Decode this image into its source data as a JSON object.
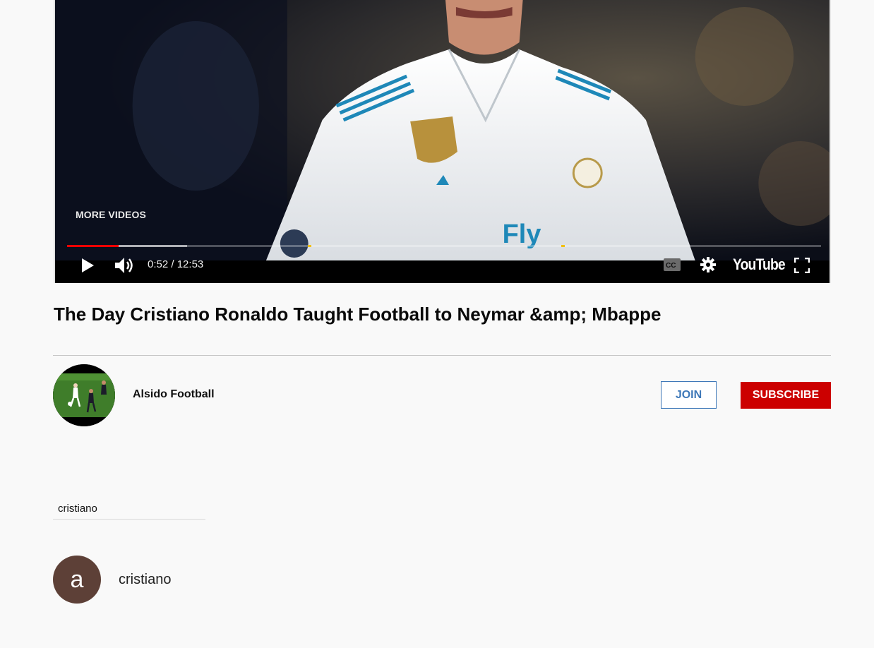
{
  "player": {
    "more_videos_label": "MORE VIDEOS",
    "time_current": "0:52",
    "time_separator": " / ",
    "time_total": "12:53",
    "played_fraction": 0.068,
    "buffered_fraction": 0.159,
    "ad_marker_fractions": [
      0.319,
      0.655
    ],
    "wordmark": "YouTube",
    "progress_color": "#ee0000",
    "ad_marker_color": "#f2c00f"
  },
  "video": {
    "title": "The Day Cristiano Ronaldo Taught Football to Neymar &amp; Mbappe"
  },
  "channel": {
    "name": "Alsido Football",
    "join_label": "JOIN",
    "subscribe_label": "SUBSCRIBE",
    "subscribe_color": "#cc0000",
    "join_color": "#3e78b8"
  },
  "search": {
    "value": "cristiano"
  },
  "user": {
    "avatar_letter": "a",
    "avatar_color": "#5d4037",
    "name": "cristiano"
  },
  "icons": [
    "play-icon",
    "volume-icon",
    "captions-icon",
    "settings-icon",
    "fullscreen-icon"
  ]
}
